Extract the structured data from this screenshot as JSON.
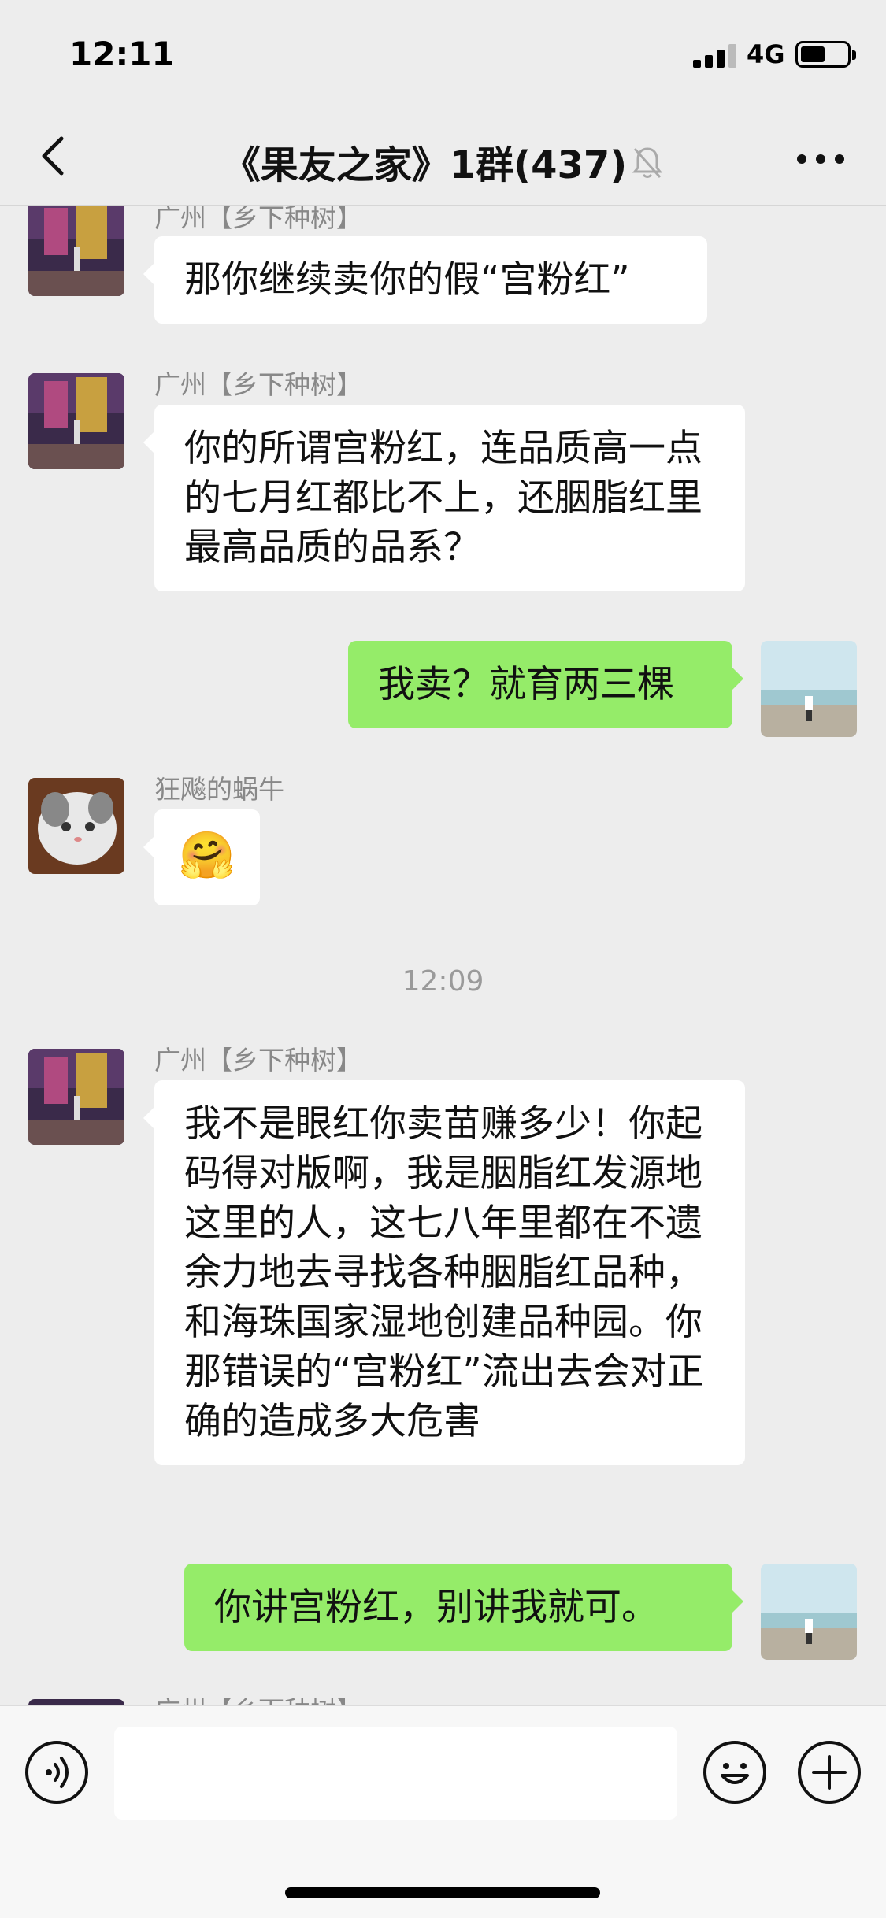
{
  "status_bar": {
    "time": "12:11",
    "network": "4G"
  },
  "nav": {
    "title": "《果友之家》1群(437)"
  },
  "messages": [
    {
      "sender": "广州【乡下种树】",
      "text": "那你继续卖你的假“宫粉红”"
    },
    {
      "sender": "广州【乡下种树】",
      "text": "你的所谓宫粉红，连品质高一点的七月红都比不上，还胭脂红里最高品质的品系？"
    },
    {
      "text": "我卖？就育两三棵"
    },
    {
      "sender": "狂飚的蜗牛",
      "emoji": "🤗"
    },
    {
      "time": "12:09"
    },
    {
      "sender": "广州【乡下种树】",
      "text": "我不是眼红你卖苗赚多少！你起码得对版啊，我是胭脂红发源地这里的人，这七八年里都在不遗余力地去寻找各种胭脂红品种，和海珠国家湿地创建品种园。你那错误的“宫粉红”流出去会对正确的造成多大危害"
    },
    {
      "text": "你讲宫粉红，别讲我就可。"
    },
    {
      "sender": "广州【乡下种树】"
    }
  ],
  "colors": {
    "outgoing_bubble": "#95ec69",
    "incoming_bubble": "#ffffff",
    "background": "#ededed"
  },
  "icons": [
    "back-icon",
    "mute-icon",
    "more-icon",
    "voice-icon",
    "emoji-icon",
    "plus-icon"
  ]
}
